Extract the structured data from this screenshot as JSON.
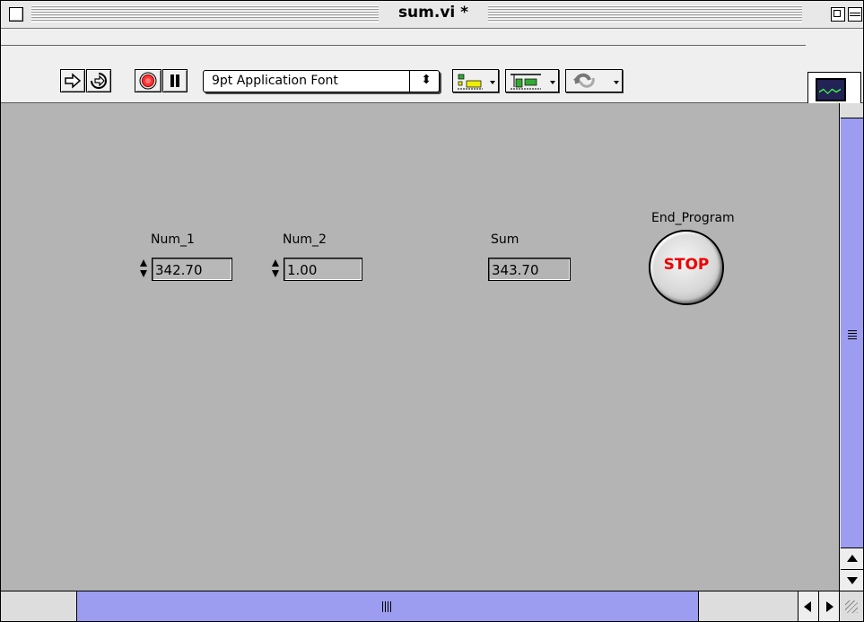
{
  "window": {
    "title": "sum.vi *"
  },
  "toolbar": {
    "run_icon": "run-arrow-icon",
    "run_continuously_icon": "run-continuously-icon",
    "abort_icon": "abort-icon",
    "pause_icon": "pause-icon",
    "font_select": "9pt Application Font",
    "align_icon": "align-objects-icon",
    "distribute_icon": "distribute-objects-icon",
    "reorder_icon": "reorder-icon",
    "vi_icon_number": "1"
  },
  "front_panel": {
    "controls": [
      {
        "label": "Num_1",
        "value": "342.70"
      },
      {
        "label": "Num_2",
        "value": "1.00"
      }
    ],
    "indicator": {
      "label": "Sum",
      "value": "343.70"
    },
    "stop_button": {
      "label": "End_Program",
      "text": "STOP"
    }
  },
  "colors": {
    "panel_bg": "#b4b4b4",
    "scroll_thumb": "#9c9cf0",
    "stop_text": "#ee0000"
  }
}
